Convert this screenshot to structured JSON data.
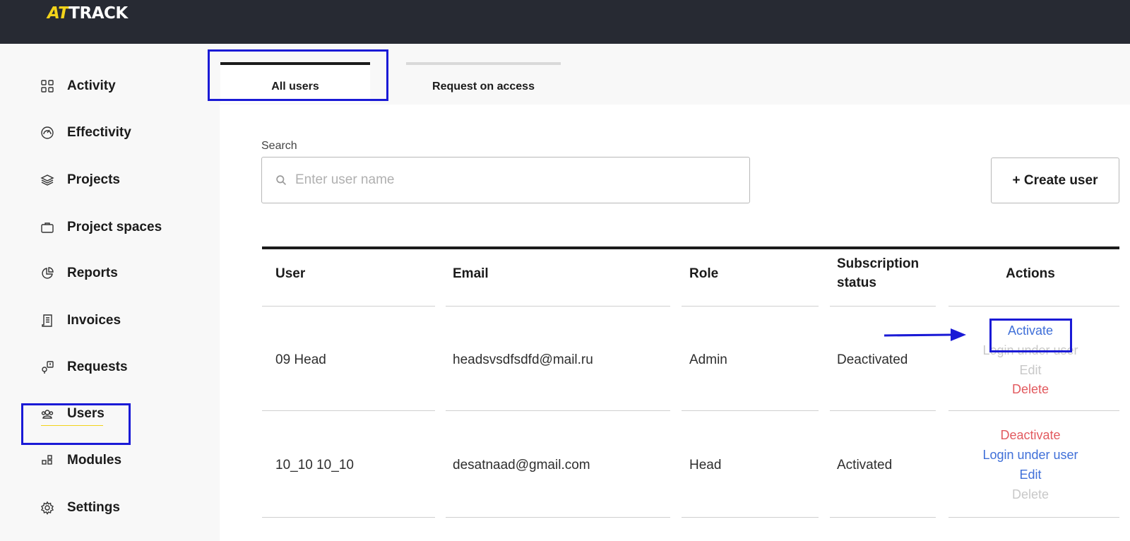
{
  "app": {
    "logo_accent": "AT",
    "logo_rest": "TRACK"
  },
  "sidebar": {
    "items": [
      {
        "label": "Activity",
        "icon": "grid-icon"
      },
      {
        "label": "Effectivity",
        "icon": "gauge-icon"
      },
      {
        "label": "Projects",
        "icon": "layers-icon"
      },
      {
        "label": "Project spaces",
        "icon": "briefcase-icon"
      },
      {
        "label": "Reports",
        "icon": "pie-chart-icon"
      },
      {
        "label": "Invoices",
        "icon": "receipt-icon"
      },
      {
        "label": "Requests",
        "icon": "request-icon"
      },
      {
        "label": "Users",
        "icon": "users-icon",
        "active": true
      },
      {
        "label": "Modules",
        "icon": "modules-icon"
      },
      {
        "label": "Settings",
        "icon": "gear-icon"
      }
    ]
  },
  "tabs": [
    {
      "label": "All users",
      "active": true
    },
    {
      "label": "Request on access",
      "active": false
    }
  ],
  "search": {
    "label": "Search",
    "placeholder": "Enter user name",
    "value": ""
  },
  "toolbar": {
    "create_label": "+ Create user"
  },
  "table": {
    "columns": [
      "User",
      "Email",
      "Role",
      "Subscription status",
      "Actions"
    ],
    "rows": [
      {
        "user": "09 Head",
        "email": "headsvsdfsdfd@mail.ru",
        "role": "Admin",
        "status": "Deactivated",
        "actions": [
          {
            "label": "Activate",
            "state": "enabled"
          },
          {
            "label": "Login under user",
            "state": "disabled"
          },
          {
            "label": "Edit",
            "state": "disabled"
          },
          {
            "label": "Delete",
            "state": "danger"
          }
        ]
      },
      {
        "user": "10_10 10_10",
        "email": "desatnaad@gmail.com",
        "role": "Head",
        "status": "Activated",
        "actions": [
          {
            "label": "Deactivate",
            "state": "danger"
          },
          {
            "label": "Login under user",
            "state": "enabled"
          },
          {
            "label": "Edit",
            "state": "enabled"
          },
          {
            "label": "Delete",
            "state": "disabled"
          }
        ]
      }
    ]
  },
  "colors": {
    "topbar": "#272a33",
    "brand_yellow": "#f2d31a",
    "link_blue": "#3f6fd8",
    "danger_red": "#e25a5f",
    "disabled_gray": "#c8c8c8",
    "highlight": "#1a1ad6"
  }
}
